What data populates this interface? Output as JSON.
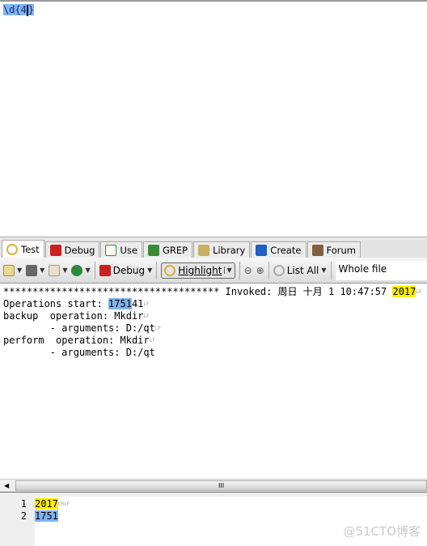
{
  "regex": {
    "value": "\\d{4",
    "value_tail": "}"
  },
  "tabs": [
    {
      "label": "Test",
      "color": "#d8b040"
    },
    {
      "label": "Debug",
      "color": "#cc2020"
    },
    {
      "label": "Use",
      "color": "#3a8a3a"
    },
    {
      "label": "GREP",
      "color": "#3a8a3a"
    },
    {
      "label": "Library",
      "color": "#c8b060"
    },
    {
      "label": "Create",
      "color": "#2060c0"
    },
    {
      "label": "Forum",
      "color": "#806040"
    }
  ],
  "toolbar": {
    "debug": "Debug",
    "highlight": "Highlight",
    "list_all": "List All",
    "scope": "Whole file"
  },
  "test": {
    "line1_pre": "************************************* Invoked: 周日 十月 1 10:47:57 ",
    "line1_match": "2017",
    "line2_pre": "Operations start: ",
    "line2_match": "1751",
    "line2_post": "41",
    "line3": "backup  operation: Mkdir",
    "line4": "        - arguments: D:/qt",
    "line5": "perform  operation: Mkdir",
    "line6": "        - arguments: D:/qt"
  },
  "results": {
    "numbers": [
      "1",
      "2"
    ],
    "matches": [
      "2017",
      "1751"
    ]
  },
  "scrollbar_grip": "III",
  "watermark": "@51CTO博客"
}
